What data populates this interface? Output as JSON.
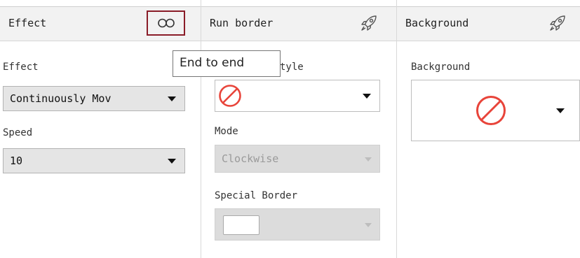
{
  "effect_panel": {
    "header_title": "Effect",
    "effect_label": "Effect",
    "effect_value": "Continuously Mov",
    "speed_label": "Speed",
    "speed_value": "10"
  },
  "run_border_panel": {
    "header_title": "Run border",
    "style_label_visible": "tyle",
    "mode_label": "Mode",
    "mode_value": "Clockwise",
    "special_border_label": "Special Border"
  },
  "background_panel": {
    "header_title": "Background",
    "background_label": "Background"
  },
  "tooltip": {
    "text": "End to end"
  },
  "icons": {
    "link": "link-icon",
    "rocket": "rocket-icon",
    "none": "no-entry-icon"
  },
  "colors": {
    "header_bg": "#f2f2f2",
    "select_bg": "#e5e5e5",
    "link_highlight": "#8a1c28",
    "none_icon": "#e8443a"
  }
}
